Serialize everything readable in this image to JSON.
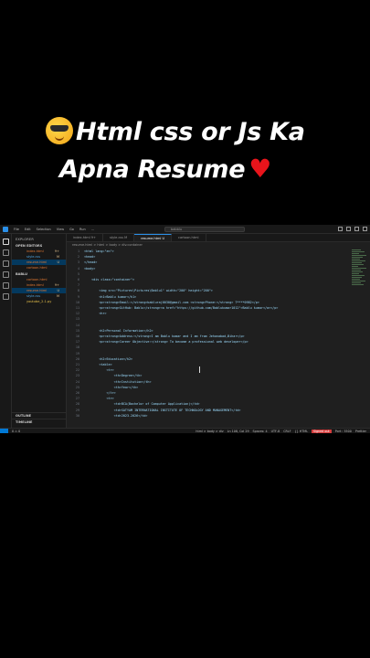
{
  "headline": {
    "line1": "Html css or Js Ka",
    "line2": "Apna Resume",
    "emoji1": "smiling-face-with-sunglasses-icon",
    "emoji2": "red-heart-icon",
    "heart_color": "#e8141b"
  },
  "titlebar": {
    "menu": [
      "File",
      "Edit",
      "Selection",
      "View",
      "Go",
      "Run",
      "..."
    ],
    "search": "babblu"
  },
  "sidebar": {
    "explorer_label": "EXPLORER",
    "open_editors_label": "OPEN EDITORS",
    "open_editors": [
      {
        "name": "index.html",
        "badge": "9+",
        "type": "html"
      },
      {
        "name": "style.css",
        "badge": "M",
        "type": "css"
      },
      {
        "name": "resume.html",
        "badge": "U",
        "type": "html",
        "selected": true
      },
      {
        "name": "cartoon.html",
        "badge": "",
        "type": "html"
      }
    ],
    "folder_label": "BABLU",
    "files": [
      {
        "name": "cartoon.html",
        "badge": "",
        "type": "html"
      },
      {
        "name": "index.html",
        "badge": "9+",
        "type": "html"
      },
      {
        "name": "resume.html",
        "badge": "U",
        "type": "html",
        "selected": true
      },
      {
        "name": "style.css",
        "badge": "M",
        "type": "css"
      },
      {
        "name": "youtube_2-1.py",
        "badge": "",
        "type": "py"
      }
    ],
    "outline_label": "OUTLINE",
    "timeline_label": "TIMELINE"
  },
  "tabs": [
    {
      "label": "index.html 9+",
      "active": false
    },
    {
      "label": "style.css M",
      "active": false
    },
    {
      "label": "resume.html U",
      "active": true
    },
    {
      "label": "cartoon.html",
      "active": false
    }
  ],
  "breadcrumb": "resume.html > html > body > div.container",
  "line_numbers": [
    "1",
    "2",
    "3",
    "4",
    "5",
    "6",
    "7",
    "8",
    "9",
    "10",
    "11",
    "12",
    "13",
    "14",
    "15",
    "16",
    "17",
    "18",
    "19",
    "20",
    "21",
    "22",
    "23",
    "24",
    "25",
    "26",
    "27",
    "28",
    "29",
    "30"
  ],
  "code_lines": [
    "<html lang=\"en\">",
    "<head>",
    "</head>",
    "<body>",
    "",
    "    <div class=\"container\">",
    "",
    "        <img src=\"Pictures\\Pictures\\Bablu1\" width=\"200\" height=\"200\">",
    "        <h1>Bablu kumar</h1>",
    "        <p><strong>Email:</strong>babluraj0030@gmail.com <strong>Phone:</strong> 7****0982</p>",
    "        <p><strong>GitHub: Bablu</strong><a href=\"https://github.com/Bablukumar1012\">Bablu kumar</a></p>",
    "        <hr>",
    "",
    "",
    "        <h2>Personal Information</h2>",
    "        <p><strong>Address:</strong>I am Bablu kumar and I am from Jehanabad,Bihar</p>",
    "        <p><strong>Career Objective:</strong> To become a professional web developer</p>",
    "",
    "",
    "        <h2>Education</h2>",
    "        <table>",
    "            <tr>",
    "                <th>Degree</th>",
    "                <th>Institution</th>",
    "                <th>Year</th>",
    "            </tr>",
    "            <tr>",
    "                <td>BCA(Bachelor of Computer Application)</td>",
    "                <td>SATYAM INTERNATIONAL INSTITUTE OF TECHNOLOGY AND MANAGEMENT</td>",
    "                <td>2023-2026</td>"
  ],
  "statusbar": {
    "left": "0 ⚠ 0",
    "items": [
      "html > body > div",
      "Ln 108, Col 29",
      "Spaces: 4",
      "UTF-8",
      "CRLF",
      "{} HTML",
      "Signed out",
      "Port : 5500",
      "Prettier"
    ]
  }
}
